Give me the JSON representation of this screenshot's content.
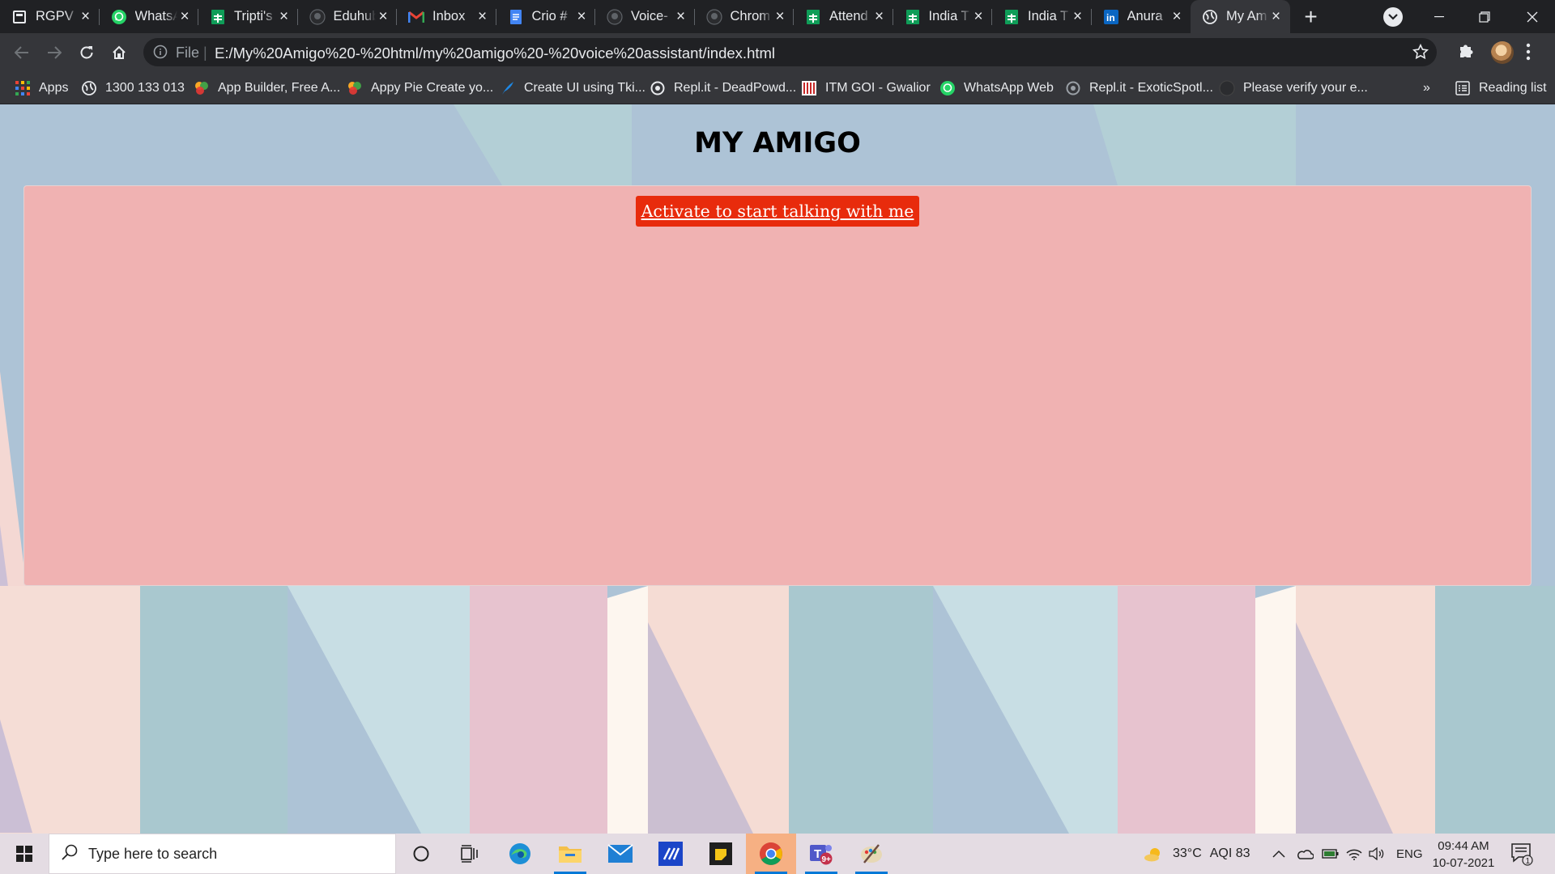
{
  "browser": {
    "tabs": [
      {
        "title": "RGPV",
        "icon": "page-icon",
        "active": false
      },
      {
        "title": "WhatsApp",
        "icon": "whatsapp-icon",
        "active": false
      },
      {
        "title": "Tripti's",
        "icon": "sheets-icon",
        "active": false
      },
      {
        "title": "Eduhub",
        "icon": "github-icon",
        "active": false
      },
      {
        "title": "Inbox",
        "icon": "gmail-icon",
        "active": false
      },
      {
        "title": "Crio #",
        "icon": "docs-icon",
        "active": false
      },
      {
        "title": "Voice-",
        "icon": "github-icon",
        "active": false
      },
      {
        "title": "Chrom",
        "icon": "github-icon",
        "active": false
      },
      {
        "title": "Attend",
        "icon": "sheets-icon",
        "active": false
      },
      {
        "title": "India T",
        "icon": "sheets-icon",
        "active": false
      },
      {
        "title": "India T",
        "icon": "sheets-icon",
        "active": false
      },
      {
        "title": "Anura",
        "icon": "linkedin-icon",
        "active": false
      },
      {
        "title": "My Am",
        "icon": "globe-icon",
        "active": true
      }
    ],
    "address": {
      "scheme_label": "File",
      "url": "E:/My%20Amigo%20-%20html/my%20amigo%20-%20voice%20assistant/index.html"
    },
    "bookmarks": [
      {
        "label": "Apps",
        "icon": "apps-grid-icon"
      },
      {
        "label": "1300 133 013",
        "icon": "globe-icon"
      },
      {
        "label": "App Builder, Free A...",
        "icon": "appypie-icon"
      },
      {
        "label": "Appy Pie Create yo...",
        "icon": "appypie-icon"
      },
      {
        "label": "Create UI using Tki...",
        "icon": "feather-icon"
      },
      {
        "label": "Repl.it - DeadPowd...",
        "icon": "replit-icon"
      },
      {
        "label": "ITM GOI - Gwalior",
        "icon": "itm-icon"
      },
      {
        "label": "WhatsApp Web",
        "icon": "whatsapp-icon"
      },
      {
        "label": "Repl.it - ExoticSpotl...",
        "icon": "replit-icon"
      },
      {
        "label": "Please verify your e...",
        "icon": "github-icon"
      }
    ],
    "more_bookmarks": "»",
    "reading_list": "Reading list"
  },
  "page": {
    "title": "MY AMIGO",
    "activate_button": "Activate to start talking with me",
    "colors": {
      "panel": "#f0b2b2",
      "button": "#e82b0c"
    }
  },
  "taskbar": {
    "search_placeholder": "Type here to search",
    "weather": "33°C",
    "aqi": "AQI 83",
    "language": "ENG",
    "time": "09:44 AM",
    "date": "10-07-2021",
    "teams_badge": "9+",
    "notification_count": "1"
  }
}
